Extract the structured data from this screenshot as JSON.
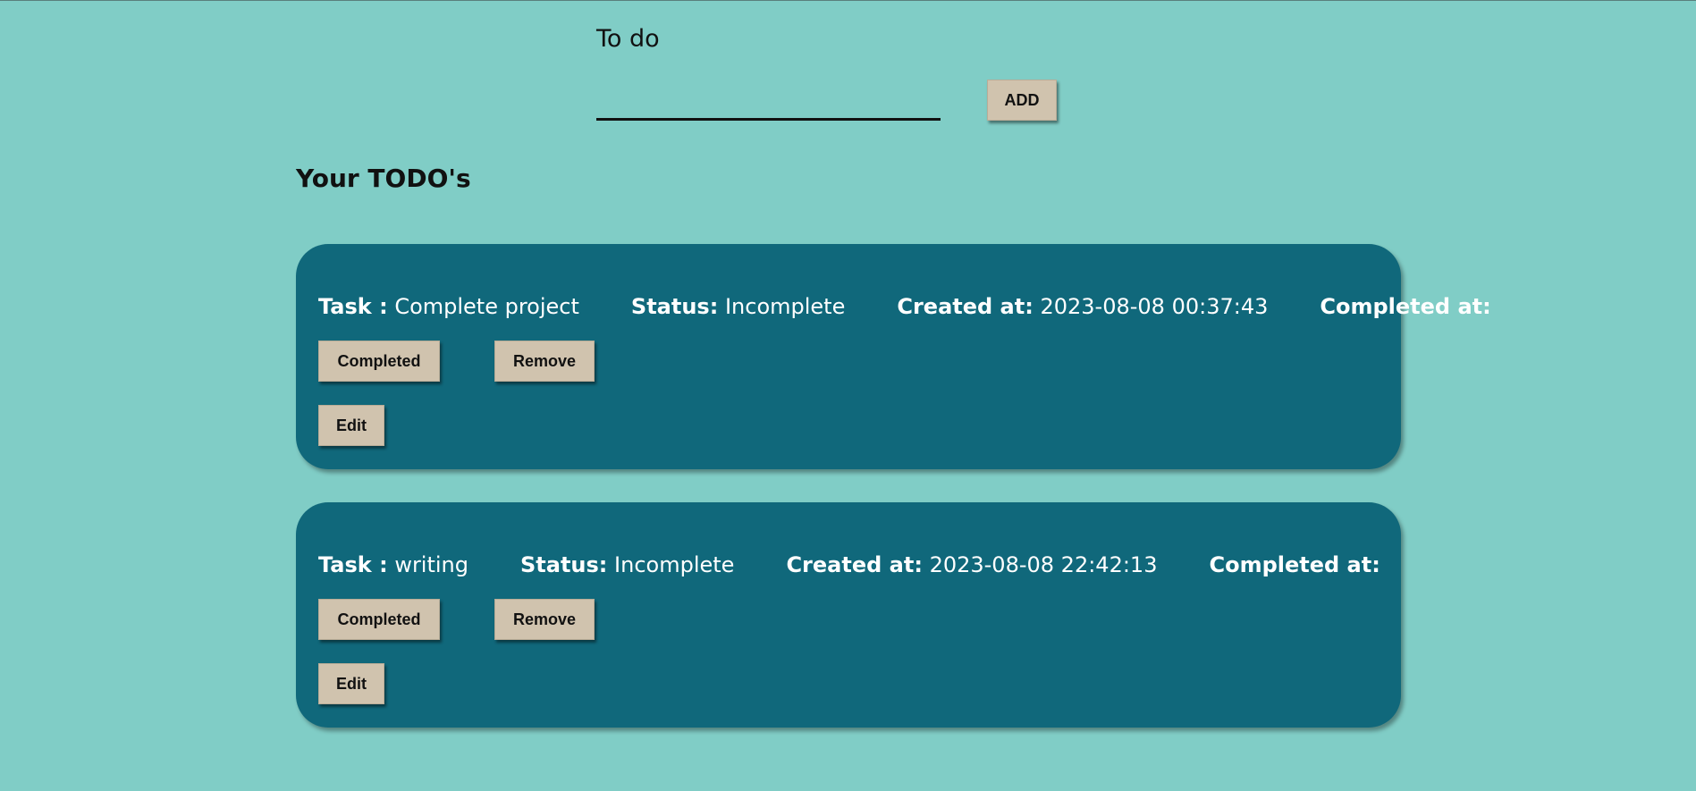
{
  "form": {
    "label": "To do",
    "input_value": "",
    "add_label": "ADD"
  },
  "list": {
    "title": "Your TODO's",
    "task_label": "Task :",
    "status_label": "Status:",
    "created_label": "Created at:",
    "completed_at_label": "Completed at:",
    "completed_button": "Completed",
    "remove_button": "Remove",
    "edit_button": "Edit",
    "items": [
      {
        "task": "Complete project",
        "status": "Incomplete",
        "created_at": "2023-08-08 00:37:43",
        "completed_at": ""
      },
      {
        "task": "writing",
        "status": "Incomplete",
        "created_at": "2023-08-08 22:42:13",
        "completed_at": ""
      }
    ]
  },
  "colors": {
    "background": "#80cdc6",
    "card": "#10687b",
    "button": "#d0c3ae"
  }
}
